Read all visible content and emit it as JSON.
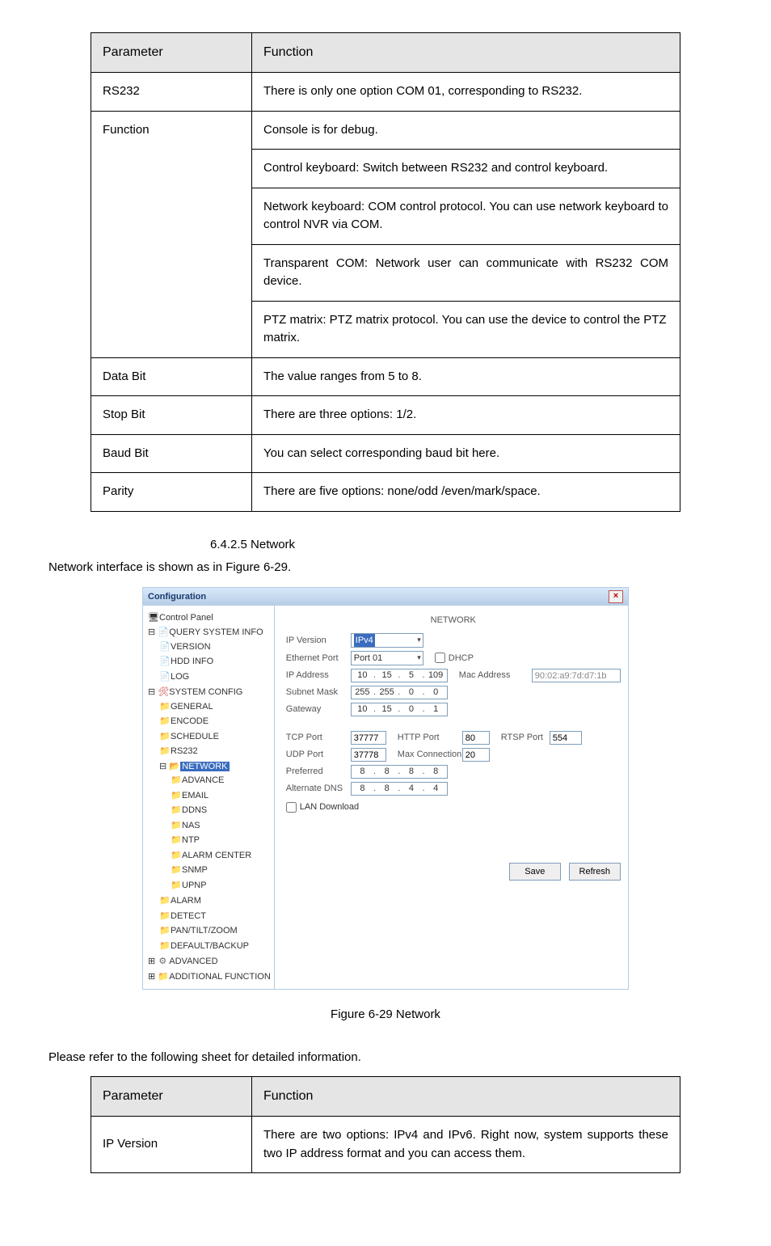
{
  "tbl1": {
    "head_param": "Parameter",
    "head_func": "Function",
    "rows": [
      {
        "p": "RS232",
        "f": "There is only one option COM 01, corresponding to RS232."
      }
    ],
    "func_block": {
      "p": "Function",
      "lines": [
        "Console is for debug.",
        "Control keyboard: Switch between RS232 and control keyboard.",
        "Network keyboard: COM control protocol. You can use network keyboard to control NVR via COM.",
        "Transparent COM: Network user can communicate with RS232 COM device.",
        "PTZ matrix: PTZ matrix protocol. You can use the device to control the PTZ matrix."
      ]
    },
    "rows_after": [
      {
        "p": "Data Bit",
        "f": "The value ranges from 5 to 8."
      },
      {
        "p": "Stop Bit",
        "f": "There are three options: 1/2."
      },
      {
        "p": "Baud Bit",
        "f": "You can select corresponding baud bit here."
      },
      {
        "p": "Parity",
        "f": "There are five options: none/odd /even/mark/space."
      }
    ]
  },
  "subhead": "6.4.2.5  Network",
  "bodytext": "Network interface is shown as in Figure 6-29.",
  "figcap": "Figure 6-29 Network",
  "lead2": "Please refer to the following sheet for detailed information.",
  "tbl2": {
    "head_param": "Parameter",
    "head_func": "Function",
    "rows": [
      {
        "p": "IP Version",
        "f": "There are two options: IPv4 and IPv6. Right now, system supports these two IP address format and you can access them."
      }
    ]
  },
  "shot": {
    "title": "Configuration",
    "section": "NETWORK",
    "tree": {
      "root": "Control Panel",
      "q": {
        "label": "QUERY SYSTEM INFO",
        "items": [
          "VERSION",
          "HDD INFO",
          "LOG"
        ]
      },
      "s": {
        "label": "SYSTEM CONFIG",
        "items": [
          "GENERAL",
          "ENCODE",
          "SCHEDULE",
          "RS232"
        ],
        "net": {
          "label": "NETWORK",
          "items": [
            "ADVANCE",
            "EMAIL",
            "DDNS",
            "NAS",
            "NTP",
            "ALARM CENTER",
            "SNMP",
            "UPNP"
          ]
        },
        "items_after": [
          "ALARM",
          "DETECT",
          "PAN/TILT/ZOOM",
          "DEFAULT/BACKUP"
        ]
      },
      "adv": "ADVANCED",
      "add": "ADDITIONAL FUNCTION"
    },
    "labels": {
      "ipver": "IP Version",
      "ethport": "Ethernet Port",
      "ipaddr": "IP Address",
      "subnet": "Subnet Mask",
      "gateway": "Gateway",
      "tcp": "TCP Port",
      "udp": "UDP Port",
      "pref": "Preferred",
      "alt": "Alternate DNS",
      "dhcp": "DHCP",
      "mac": "Mac Address",
      "http": "HTTP Port",
      "maxc": "Max Connection",
      "rtsp": "RTSP Port",
      "lan": "LAN Download",
      "save": "Save",
      "refresh": "Refresh"
    },
    "values": {
      "ipver": "IPv4",
      "ethport": "Port 01",
      "ip": [
        "10",
        "15",
        "5",
        "109"
      ],
      "mask": [
        "255",
        "255",
        "0",
        "0"
      ],
      "gw": [
        "10",
        "15",
        "0",
        "1"
      ],
      "tcp": "37777",
      "udp": "37778",
      "pref": [
        "8",
        "8",
        "8",
        "8"
      ],
      "alt": [
        "8",
        "8",
        "4",
        "4"
      ],
      "mac": "90:02:a9:7d:d7:1b",
      "http": "80",
      "maxc": "20",
      "rtsp": "554"
    }
  }
}
